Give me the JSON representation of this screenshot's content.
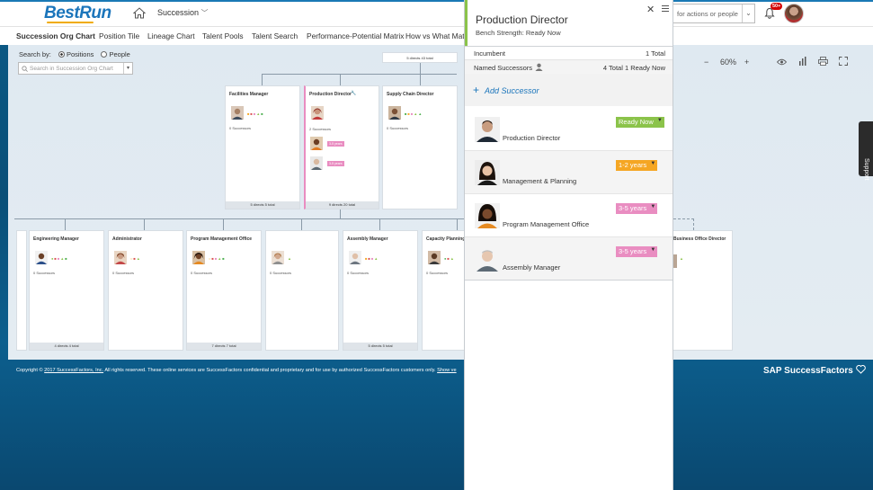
{
  "header": {
    "logo_text": "BestRun",
    "module_menu_label": "Succession",
    "search_placeholder": "for actions or people",
    "notification_count": "50+"
  },
  "tabs": [
    {
      "label": "Succession Org Chart",
      "active": true
    },
    {
      "label": "Position Tile",
      "active": false
    },
    {
      "label": "Lineage Chart",
      "active": false
    },
    {
      "label": "Talent Pools",
      "active": false
    },
    {
      "label": "Talent Search",
      "active": false
    },
    {
      "label": "Performance-Potential Matrix",
      "active": false
    },
    {
      "label": "How vs What Matrix",
      "active": false
    }
  ],
  "search": {
    "search_by_label": "Search by:",
    "option_positions": "Positions",
    "option_people": "People",
    "selected": "Positions",
    "org_search_placeholder": "Search in Succession Org Chart"
  },
  "zoom": {
    "minus": "−",
    "level": "60%",
    "plus": "+"
  },
  "org_chart": {
    "top_box_footer": "5 directs 43 total",
    "level1": [
      {
        "title": "Facilities Manager",
        "successors": "0 Successors",
        "footer": "5 directs 5 total"
      },
      {
        "title": "Production Director",
        "successors": "2 Successors",
        "footer": "9 directs 20 total",
        "badges": [
          "3-5 years",
          "3-5 years"
        ]
      },
      {
        "title": "Supply Chain Director",
        "successors": "0 Successors",
        "footer": ""
      }
    ],
    "level2": [
      {
        "title": "Engineering Manager",
        "successors": "0 Successors",
        "footer": "4 directs 4 total"
      },
      {
        "title": "Administrator",
        "successors": "0 Successors",
        "footer": ""
      },
      {
        "title": "Program Management Office",
        "successors": "0 Successors",
        "footer": "7 directs 7 total"
      },
      {
        "title": "",
        "successors": "0 Successors",
        "footer": ""
      },
      {
        "title": "Assembly Manager",
        "successors": "0 Successors",
        "footer": "5 directs 5 total"
      },
      {
        "title": "Capacity Planning I",
        "successors": "0 Successors",
        "footer": ""
      },
      {
        "title": "Business Office Director",
        "successors": "",
        "footer": ""
      }
    ]
  },
  "panel": {
    "title": "Production Director",
    "bench_strength": "Bench Strength:  Ready Now",
    "incumbent_label": "Incumbent",
    "incumbent_total": "1 Total",
    "named_successors_label": "Named Successors",
    "named_successors_summary": "4 Total 1 Ready Now",
    "add_successor_label": "Add Successor",
    "successors": [
      {
        "role": "Production Director",
        "readiness": "Ready Now",
        "color": "#8bc34a"
      },
      {
        "role": "Management & Planning",
        "readiness": "1-2 years",
        "color": "#f5a623"
      },
      {
        "role": "Program Management Office",
        "readiness": "3-5 years",
        "color": "#e98dc1"
      },
      {
        "role": "Assembly Manager",
        "readiness": "3-5 years",
        "color": "#e98dc1"
      }
    ]
  },
  "footer": {
    "copyright_prefix": "Copyright © ",
    "copyright_link": "2017 SuccessFactors, Inc.",
    "copyright_suffix": " All rights reserved. These online services are SuccessFactors confidential and proprietary and for use by authorized SuccessFactors customers only. ",
    "show_link": "Show ve",
    "brand": "SAP SuccessFactors"
  },
  "support_label": "Support",
  "colors": {
    "brand_blue": "#1b75bb",
    "ready_now": "#8bc34a",
    "one_two_years": "#f5a623",
    "three_five_years": "#e98dc1"
  }
}
